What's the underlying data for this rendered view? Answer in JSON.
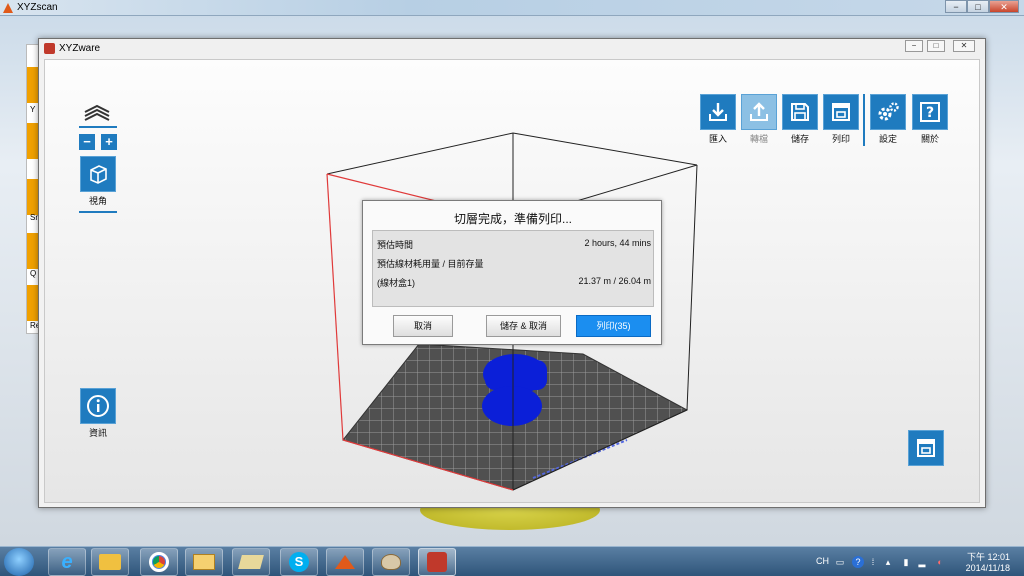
{
  "background_app": {
    "title": "XYZscan",
    "side_labels": [
      "Y",
      "Sn",
      "Q",
      "Re"
    ]
  },
  "window": {
    "title": "XYZware",
    "controls": [
      "−",
      "□",
      "✕"
    ]
  },
  "toolbar": {
    "import_label": "匯入",
    "convert_label": "轉檔",
    "save_label": "儲存",
    "print_label": "列印",
    "settings_label": "設定",
    "about_label": "關於"
  },
  "left_panel": {
    "zoom_out": "−",
    "zoom_in": "+",
    "view_label": "視角",
    "info_label": "資訊"
  },
  "dialog": {
    "title": "切層完成，準備列印...",
    "rows": [
      {
        "label": "預估時間",
        "value": "2 hours, 44 mins"
      },
      {
        "label": "預估線材耗用量 / 目前存量",
        "value": ""
      },
      {
        "label": "(線材盒1)",
        "value": "21.37 m / 26.04 m"
      }
    ],
    "cancel_label": "取消",
    "save_cancel_label": "儲存 & 取消",
    "print_label": "列印(35)"
  },
  "taskbar": {
    "lang": "CH",
    "time": "下午 12:01",
    "date": "2014/11/18"
  },
  "colors": {
    "accent": "#1f7bbf",
    "model": "#0b1fd8",
    "print_button": "#1b8ef0",
    "build_box_red": "#e03a3a"
  }
}
